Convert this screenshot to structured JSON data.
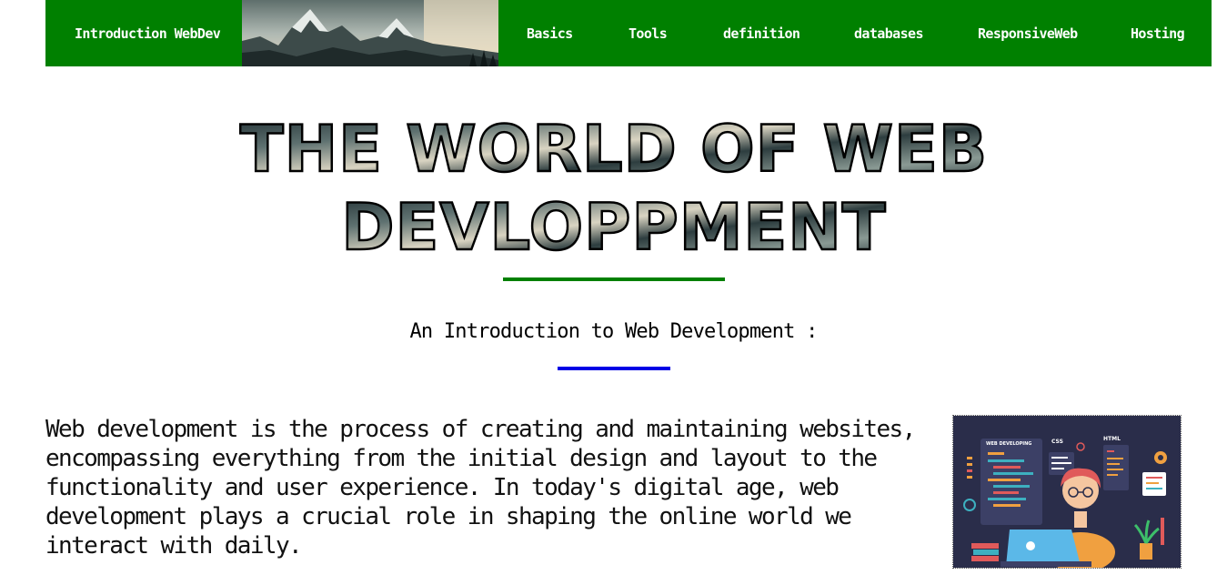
{
  "nav": {
    "brand": "Introduction WebDev",
    "links": [
      "Basics",
      "Tools",
      "definition",
      "databases",
      "ResponsiveWeb",
      "Hosting"
    ]
  },
  "hero": {
    "title_line1": "THE WORLD OF WEB",
    "title_line2": "DEVLOPPMENT",
    "subtitle": "An Introduction to Web Development :"
  },
  "intro": {
    "paragraph": "Web development is the process of creating and maintaining websites, encompassing everything from the initial design and layout to the functionality and user experience. In today's digital age, web development plays a crucial role in shaping the online world we interact with daily."
  },
  "illustration": {
    "panel_label": "WEB DEVELOPING",
    "css_label": "CSS",
    "html_label": "HTML"
  },
  "colors": {
    "nav_bg": "#008000",
    "rule_green": "#008000",
    "rule_blue": "#0000e6",
    "illustration_bg": "#2a2d4a"
  },
  "icons": [
    "mountain-banner-image",
    "developer-illustration"
  ]
}
